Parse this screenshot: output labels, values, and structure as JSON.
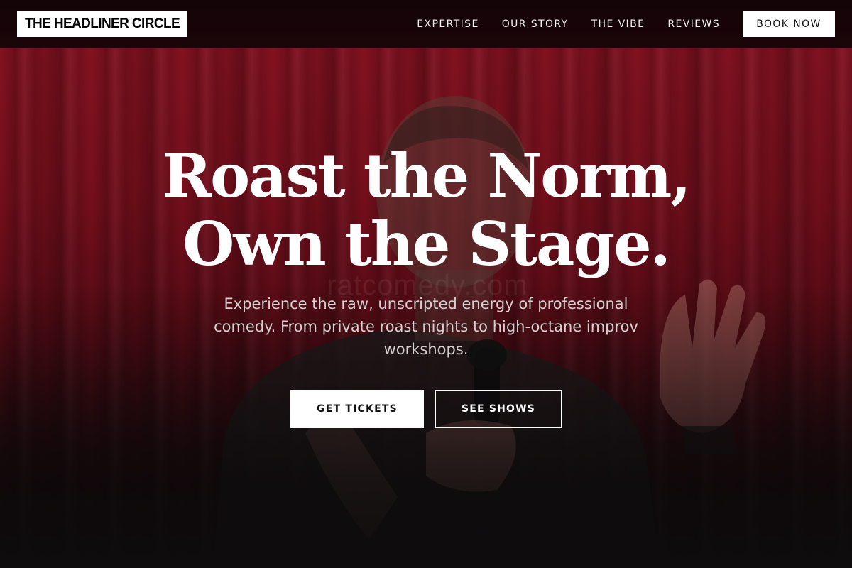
{
  "brand": {
    "logo_text": "THE HEADLINER CIRCLE"
  },
  "nav": {
    "links": [
      {
        "label": "EXPERTISE"
      },
      {
        "label": "OUR STORY"
      },
      {
        "label": "THE VIBE"
      },
      {
        "label": "REVIEWS"
      }
    ],
    "cta_label": "BOOK NOW"
  },
  "hero": {
    "headline_line1": "Roast the Norm,",
    "headline_line2": "Own the Stage.",
    "subtext": "Experience the raw, unscripted energy of professional comedy. From private roast nights to high-octane improv workshops.",
    "primary_cta": "GET TICKETS",
    "secondary_cta": "SEE SHOWS",
    "watermark": "ratcomedy.com"
  },
  "colors": {
    "curtain": "#7a0f1d",
    "nav_bg": "#160408",
    "button_light": "#ffffff"
  }
}
